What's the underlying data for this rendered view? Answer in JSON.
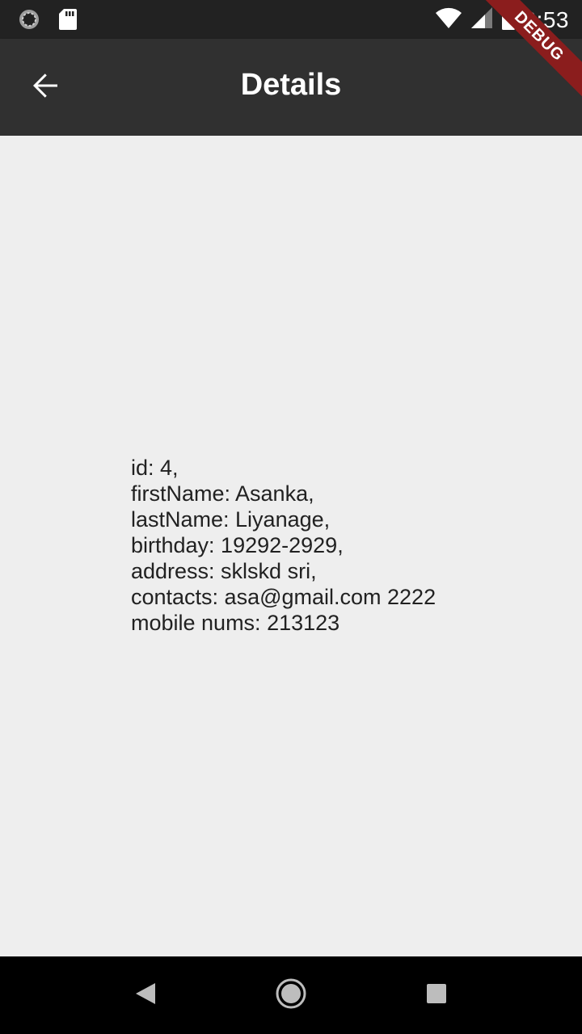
{
  "status_bar": {
    "time": "6:53"
  },
  "app_bar": {
    "title": "Details",
    "back_icon": "arrow-back-icon"
  },
  "debug_banner": {
    "label": "DEBUG"
  },
  "details": {
    "lines": [
      "id: 4,",
      "firstName: Asanka,",
      "lastName: Liyanage,",
      "birthday: 19292-2929,",
      "address: sklskd sri,",
      "contacts: asa@gmail.com 2222",
      "mobile nums: 213123"
    ]
  },
  "colors": {
    "status_bar_bg": "#222222",
    "app_bar_bg": "#303030",
    "content_bg": "#eeeeee",
    "debug_banner": "#8b1d1d",
    "nav_bar_bg": "#000000"
  }
}
